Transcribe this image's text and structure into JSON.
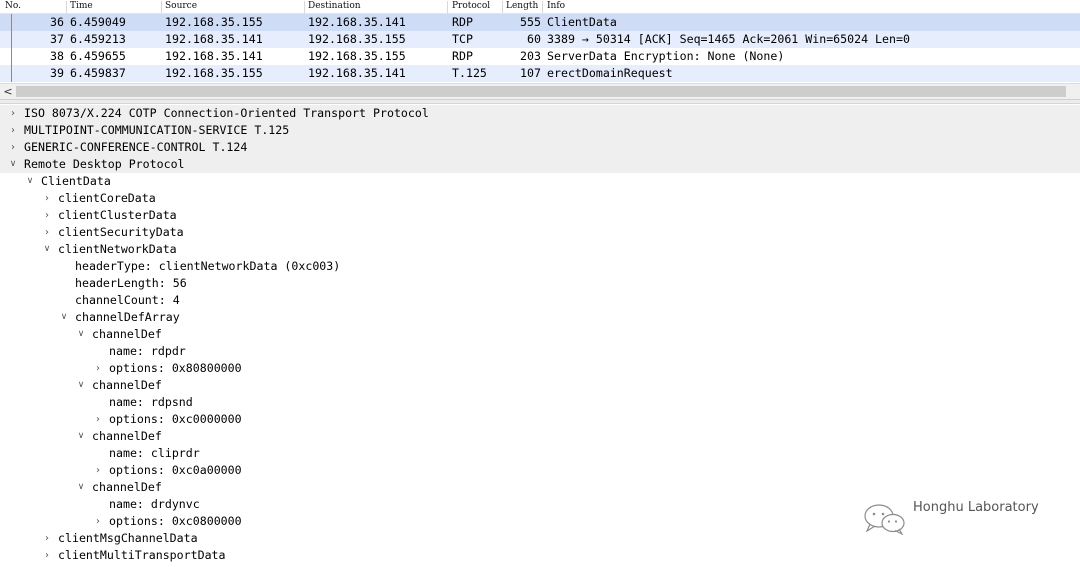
{
  "columns": {
    "no": "No.",
    "time": "Time",
    "source": "Source",
    "destination": "Destination",
    "protocol": "Protocol",
    "length": "Length",
    "info": "Info"
  },
  "packets": [
    {
      "no": "36",
      "time": "6.459049",
      "source": "192.168.35.155",
      "destination": "192.168.35.141",
      "protocol": "RDP",
      "length": "555",
      "info": "ClientData"
    },
    {
      "no": "37",
      "time": "6.459213",
      "source": "192.168.35.141",
      "destination": "192.168.35.155",
      "protocol": "TCP",
      "length": "60",
      "info": "3389 → 50314 [ACK] Seq=1465 Ack=2061 Win=65024 Len=0"
    },
    {
      "no": "38",
      "time": "6.459655",
      "source": "192.168.35.141",
      "destination": "192.168.35.155",
      "protocol": "RDP",
      "length": "203",
      "info": "ServerData Encryption: None (None)"
    },
    {
      "no": "39",
      "time": "6.459837",
      "source": "192.168.35.155",
      "destination": "192.168.35.141",
      "protocol": "T.125",
      "length": "107",
      "info": "erectDomainRequest"
    }
  ],
  "scroll_left_glyph": "<",
  "tree": [
    {
      "label": "ISO 8073/X.224 COTP Connection-Oriented Transport Protocol",
      "expander": "closed"
    },
    {
      "label": "MULTIPOINT-COMMUNICATION-SERVICE T.125",
      "expander": "closed"
    },
    {
      "label": "GENERIC-CONFERENCE-CONTROL T.124",
      "expander": "closed"
    },
    {
      "label": "Remote Desktop Protocol",
      "expander": "open"
    },
    {
      "label": "ClientData",
      "expander": "open"
    },
    {
      "label": "clientCoreData",
      "expander": "closed"
    },
    {
      "label": "clientClusterData",
      "expander": "closed"
    },
    {
      "label": "clientSecurityData",
      "expander": "closed"
    },
    {
      "label": "clientNetworkData",
      "expander": "open"
    },
    {
      "label": "headerType: clientNetworkData (0xc003)",
      "expander": "none"
    },
    {
      "label": "headerLength: 56",
      "expander": "none"
    },
    {
      "label": "channelCount: 4",
      "expander": "none"
    },
    {
      "label": "channelDefArray",
      "expander": "open"
    },
    {
      "label": "channelDef",
      "expander": "open"
    },
    {
      "label": "name: rdpdr",
      "expander": "none"
    },
    {
      "label": "options: 0x80800000",
      "expander": "closed"
    },
    {
      "label": "channelDef",
      "expander": "open"
    },
    {
      "label": "name: rdpsnd",
      "expander": "none"
    },
    {
      "label": "options: 0xc0000000",
      "expander": "closed"
    },
    {
      "label": "channelDef",
      "expander": "open"
    },
    {
      "label": "name: cliprdr",
      "expander": "none"
    },
    {
      "label": "options: 0xc0a00000",
      "expander": "closed"
    },
    {
      "label": "channelDef",
      "expander": "open"
    },
    {
      "label": "name: drdynvc",
      "expander": "none"
    },
    {
      "label": "options: 0xc0800000",
      "expander": "closed"
    },
    {
      "label": "clientMsgChannelData",
      "expander": "closed"
    },
    {
      "label": "clientMultiTransportData",
      "expander": "closed"
    }
  ],
  "watermark": {
    "text": "Honghu Laboratory",
    "icon": "wechat-icon"
  },
  "colors": {
    "selected_row": "#cfdcf6",
    "alt_row": "#e6edfc",
    "band_row": "#efefef"
  }
}
